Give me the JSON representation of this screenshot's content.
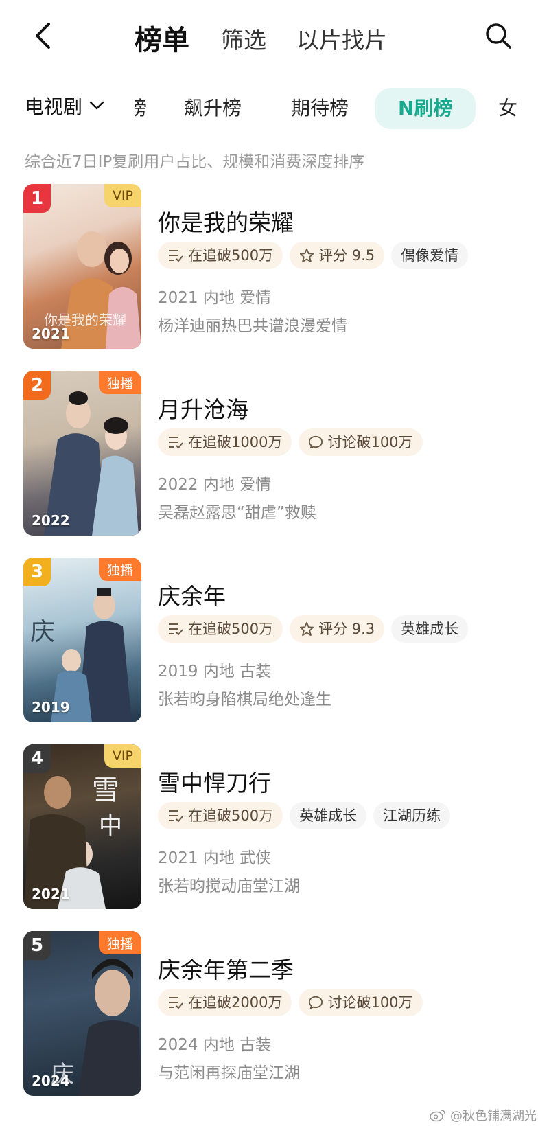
{
  "header": {
    "tabs": [
      {
        "label": "榜单",
        "active": true
      },
      {
        "label": "筛选",
        "active": false
      },
      {
        "label": "以片找片",
        "active": false
      }
    ],
    "back_icon": "chevron-left-icon",
    "search_icon": "search-icon"
  },
  "categories": {
    "dropdown": "电视剧",
    "chips": [
      "榜",
      "飙升榜",
      "期待榜",
      "N刷榜",
      "女"
    ],
    "active": "N刷榜"
  },
  "description": "综合近7日IP复刷用户占比、规模和消费深度排序",
  "accent": "#19a98e",
  "rank_colors": [
    "#e8363f",
    "#f26a1b",
    "#f2b01e",
    "#3a3a3a",
    "#3a3a3a"
  ],
  "items": [
    {
      "rank": "1",
      "badge": "VIP",
      "badge_type": "vip",
      "poster_year": "2021",
      "title": "你是我的荣耀",
      "tags": [
        {
          "icon": "list-icon",
          "text": "在追破500万",
          "style": "warm"
        },
        {
          "icon": "star-icon",
          "text": "评分 9.5",
          "style": "warm"
        },
        {
          "icon": "",
          "text": "偶像爱情",
          "style": "plain"
        }
      ],
      "meta": "2021 内地 爱情",
      "subtitle": "杨洋迪丽热巴共谱浪漫爱情"
    },
    {
      "rank": "2",
      "badge": "独播",
      "badge_type": "excl",
      "poster_year": "2022",
      "title": "月升沧海",
      "tags": [
        {
          "icon": "list-icon",
          "text": "在追破1000万",
          "style": "warm"
        },
        {
          "icon": "comment-icon",
          "text": "讨论破100万",
          "style": "warm"
        }
      ],
      "meta": "2022 内地 爱情",
      "subtitle": "吴磊赵露思“甜虐”救赎"
    },
    {
      "rank": "3",
      "badge": "独播",
      "badge_type": "excl",
      "poster_year": "2019",
      "title": "庆余年",
      "tags": [
        {
          "icon": "list-icon",
          "text": "在追破500万",
          "style": "warm"
        },
        {
          "icon": "star-icon",
          "text": "评分 9.3",
          "style": "warm"
        },
        {
          "icon": "",
          "text": "英雄成长",
          "style": "plain"
        }
      ],
      "meta": "2019 内地 古装",
      "subtitle": "张若昀身陷棋局绝处逢生"
    },
    {
      "rank": "4",
      "badge": "VIP",
      "badge_type": "vip",
      "poster_year": "2021",
      "title": "雪中悍刀行",
      "tags": [
        {
          "icon": "list-icon",
          "text": "在追破500万",
          "style": "warm"
        },
        {
          "icon": "",
          "text": "英雄成长",
          "style": "plain"
        },
        {
          "icon": "",
          "text": "江湖历练",
          "style": "plain"
        }
      ],
      "meta": "2021 内地 武侠",
      "subtitle": "张若昀搅动庙堂江湖"
    },
    {
      "rank": "5",
      "badge": "独播",
      "badge_type": "excl",
      "poster_year": "2024",
      "title": "庆余年第二季",
      "tags": [
        {
          "icon": "list-icon",
          "text": "在追破2000万",
          "style": "warm"
        },
        {
          "icon": "comment-icon",
          "text": "讨论破100万",
          "style": "warm"
        }
      ],
      "meta": "2024 内地 古装",
      "subtitle": "与范闲再探庙堂江湖"
    }
  ],
  "watermark": "@秋色铺满湖光"
}
